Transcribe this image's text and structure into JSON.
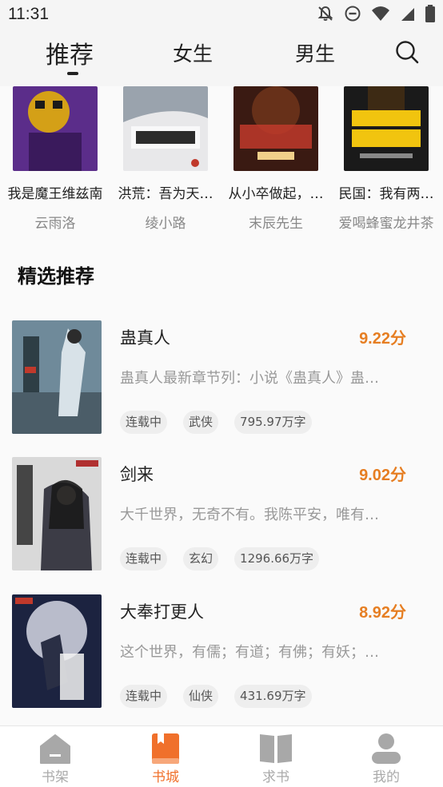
{
  "status_bar": {
    "time": "11:31"
  },
  "top_tabs": [
    {
      "label": "推荐",
      "active": true
    },
    {
      "label": "女生",
      "active": false
    },
    {
      "label": "男生",
      "active": false
    }
  ],
  "book_strip": [
    {
      "title": "我是魔王维兹南",
      "author": "云雨洛",
      "cover_colors": [
        "#5b2d8a",
        "#d4a017"
      ]
    },
    {
      "title": "洪荒：吾为天…",
      "author": "绫小路",
      "cover_colors": [
        "#e8e8ea",
        "#3a3a3a"
      ]
    },
    {
      "title": "从小卒做起，…",
      "author": "末辰先生",
      "cover_colors": [
        "#3a1a12",
        "#c0392b"
      ]
    },
    {
      "title": "民国：我有两…",
      "author": "爱喝蜂蜜龙井茶",
      "cover_colors": [
        "#1a1a1a",
        "#f1c40f"
      ]
    }
  ],
  "section": {
    "title": "精选推荐"
  },
  "recommendations": [
    {
      "title": "蛊真人",
      "score": "9.22分",
      "desc": "蛊真人最新章节列：小说《蛊真人》蛊…",
      "tags": [
        "连载中",
        "武侠",
        "795.97万字"
      ],
      "cover_colors": [
        "#6f8a9a",
        "#c8d6de"
      ]
    },
    {
      "title": "剑来",
      "score": "9.02分",
      "desc": "大千世界，无奇不有。我陈平安，唯有…",
      "tags": [
        "连载中",
        "玄幻",
        "1296.66万字"
      ],
      "cover_colors": [
        "#d9d9d9",
        "#3c3c46"
      ]
    },
    {
      "title": "大奉打更人",
      "score": "8.92分",
      "desc": "这个世界，有儒；有道；有佛；有妖；…",
      "tags": [
        "连载中",
        "仙侠",
        "431.69万字"
      ],
      "cover_colors": [
        "#1c2340",
        "#b9bccb"
      ]
    }
  ],
  "bottom_nav": [
    {
      "label": "书架",
      "icon": "house-icon",
      "active": false
    },
    {
      "label": "书城",
      "icon": "book-icon",
      "active": true
    },
    {
      "label": "求书",
      "icon": "open-book-icon",
      "active": false
    },
    {
      "label": "我的",
      "icon": "person-icon",
      "active": false
    }
  ],
  "colors": {
    "accent": "#f0702b",
    "score": "#e67e22"
  }
}
